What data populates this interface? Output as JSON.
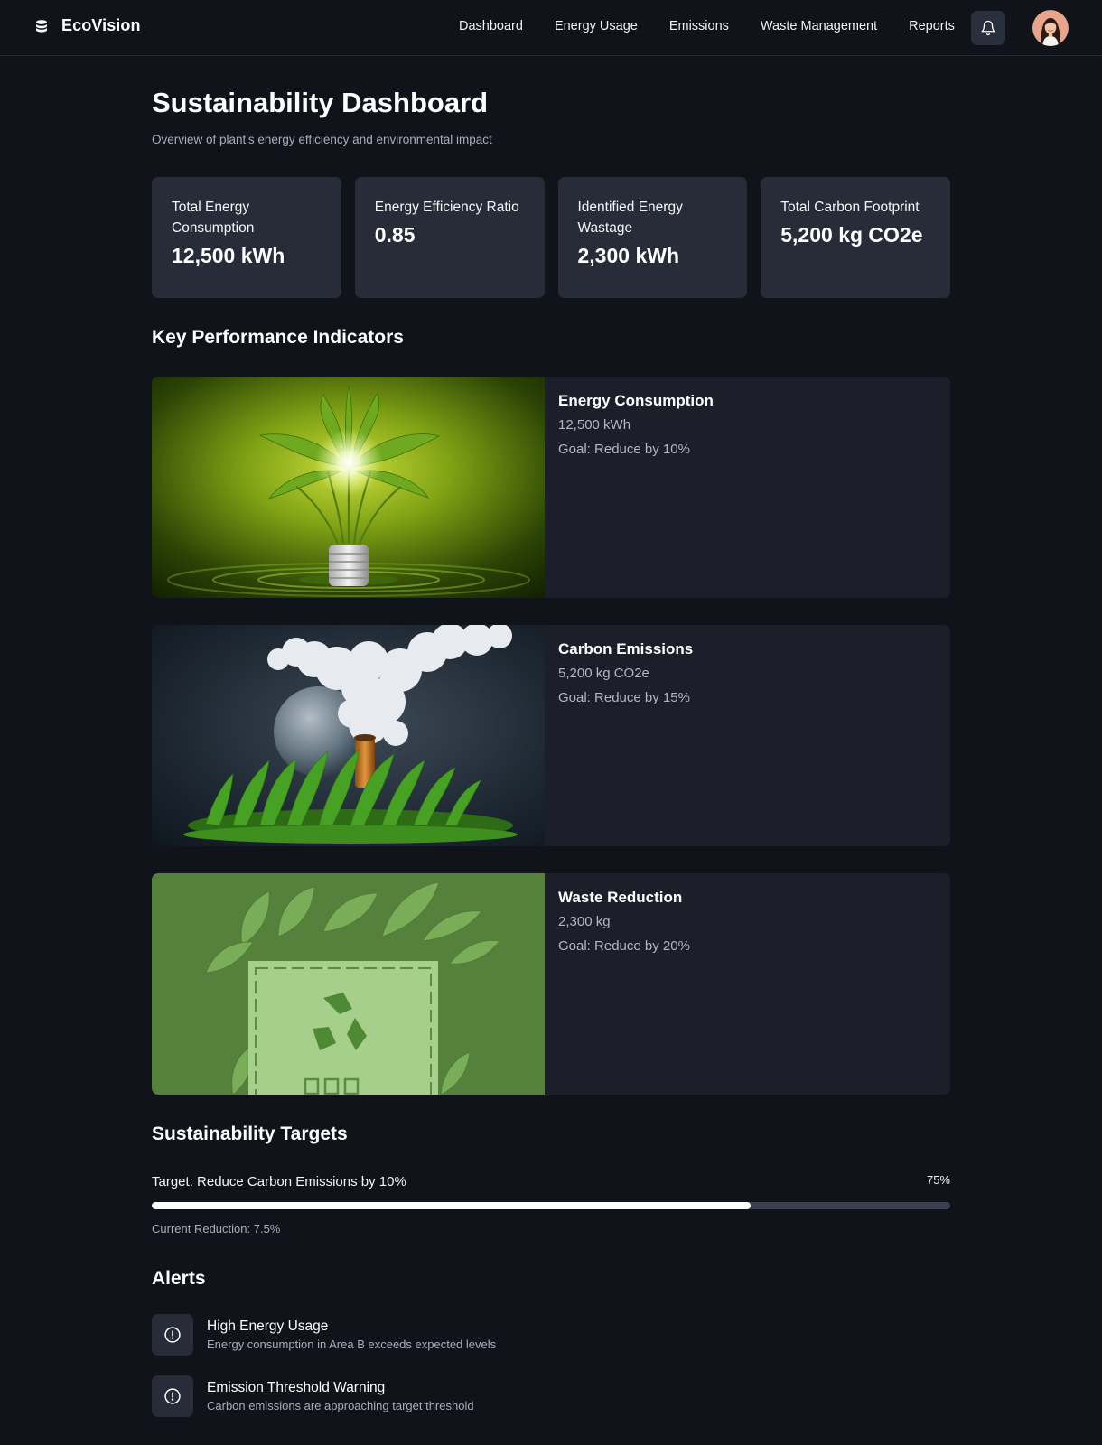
{
  "header": {
    "brand_name": "EcoVision",
    "brand_icon": "database-stack-icon",
    "nav": [
      "Dashboard",
      "Energy Usage",
      "Emissions",
      "Waste Management",
      "Reports"
    ],
    "notification_icon": "bell-icon",
    "avatar_icon": "user-avatar"
  },
  "page": {
    "title": "Sustainability Dashboard",
    "subtitle": "Overview of plant's energy efficiency and environmental impact"
  },
  "stats": [
    {
      "label": "Total Energy Consumption",
      "value": "12,500 kWh"
    },
    {
      "label": "Energy Efficiency Ratio",
      "value": "0.85"
    },
    {
      "label": "Identified Energy Wastage",
      "value": "2,300 kWh"
    },
    {
      "label": "Total Carbon Footprint",
      "value": "5,200 kg CO2e"
    }
  ],
  "kpi": {
    "section_title": "Key Performance Indicators",
    "items": [
      {
        "title": "Energy Consumption",
        "value": "12,500 kWh",
        "goal": "Goal: Reduce by 10%",
        "image": "plant-lightbulb"
      },
      {
        "title": "Carbon Emissions",
        "value": "5,200 kg CO2e",
        "goal": "Goal: Reduce by 15%",
        "image": "smoke-globe-grass"
      },
      {
        "title": "Waste Reduction",
        "value": "2,300 kg",
        "goal": "Goal: Reduce by 20%",
        "image": "recycle-box-leaves"
      }
    ]
  },
  "targets": {
    "section_title": "Sustainability Targets",
    "target_label": "Target: Reduce Carbon Emissions by 10%",
    "progress_label": "75%",
    "progress": 0.75,
    "current_reduction": "Current Reduction: 7.5%"
  },
  "alerts": {
    "section_title": "Alerts",
    "icon": "alert-circle-icon",
    "items": [
      {
        "title": "High Energy Usage",
        "description": "Energy consumption in Area B exceeds expected levels"
      },
      {
        "title": "Emission Threshold Warning",
        "description": "Carbon emissions are approaching target threshold"
      }
    ]
  },
  "colors": {
    "background": "#11131b",
    "card": "#272c38",
    "kpi_card": "#1c1f29",
    "progress_track": "#3a4050",
    "progress_fill": "#ffffff"
  }
}
